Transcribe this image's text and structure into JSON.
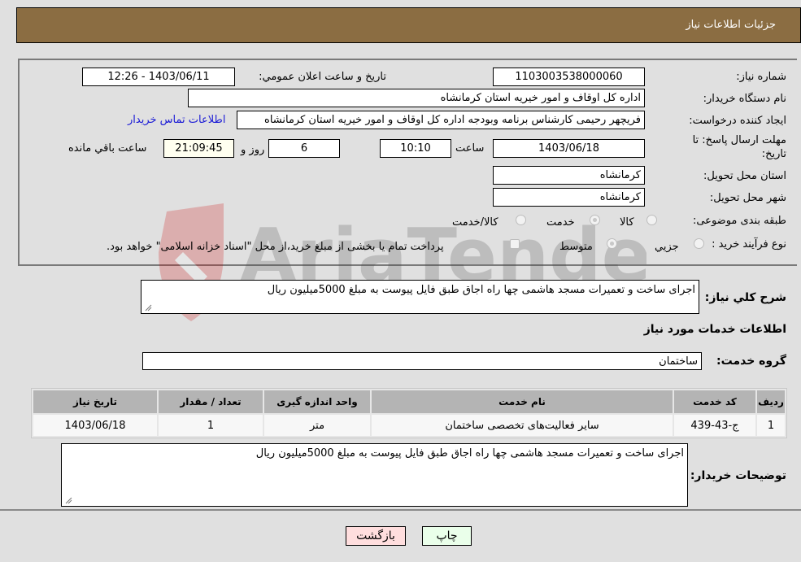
{
  "header": {
    "title": "جزئیات اطلاعات نیاز"
  },
  "form": {
    "need_number": {
      "label": "شماره نیاز:",
      "value": "1103003538000060"
    },
    "announce_datetime": {
      "label": "تاریخ و ساعت اعلان عمومي:",
      "value": "1403/06/11 - 12:26"
    },
    "buyer_org": {
      "label": "نام دستگاه خریدار:",
      "value": "اداره کل اوقاف و امور خیریه استان کرمانشاه"
    },
    "requester": {
      "label": "ایجاد کننده درخواست:",
      "value": "فریچهر رحیمی کارشناس برنامه وبودجه اداره کل اوقاف و امور خیریه استان کرمانشاه",
      "contact_link": "اطلاعات تماس خریدار"
    },
    "deadline": {
      "label_line1": "مهلت ارسال پاسخ: تا",
      "label_line2": "تاریخ:",
      "date": "1403/06/18",
      "time_label": "ساعت",
      "time": "10:10",
      "days": "6",
      "days_label": "روز و",
      "remaining": "21:09:45",
      "remaining_label": "ساعت باقي مانده"
    },
    "delivery_province": {
      "label": "استان محل تحویل:",
      "value": "کرمانشاه"
    },
    "delivery_city": {
      "label": "شهر محل تحویل:",
      "value": "کرمانشاه"
    },
    "category": {
      "label": "طبقه بندی موضوعی:",
      "options": [
        "کالا",
        "خدمت",
        "کالا/خدمت"
      ],
      "selected": "خدمت"
    },
    "purchase_type": {
      "label": "نوع فرآیند خرید :",
      "options": [
        "جزيي",
        "متوسط"
      ],
      "selected": "متوسط",
      "treasury_note": "پرداخت تمام یا بخشی از مبلغ خرید،از محل \"اسناد خزانه اسلامی\" خواهد بود."
    }
  },
  "summary": {
    "label": "شرح کلي نیاز:",
    "value": "اجرای ساخت و تعمیرات مسجد هاشمی چها راه اجاق طبق فایل پیوست به مبلغ 5000میلیون ریال"
  },
  "services_section": {
    "title": "اطلاعات خدمات مورد نیاز",
    "group_label": "گروه خدمت:",
    "group_value": "ساختمان",
    "table": {
      "headers": [
        "ردیف",
        "کد خدمت",
        "نام خدمت",
        "واحد اندازه گیری",
        "تعداد / مقدار",
        "تاریخ نیاز"
      ],
      "rows": [
        [
          "1",
          "ج-43-439",
          "سایر فعالیت‌های تخصصی ساختمان",
          "متر",
          "1",
          "1403/06/18"
        ]
      ]
    }
  },
  "buyer_notes": {
    "label": "توضیحات خریدار:",
    "value": "اجرای ساخت و تعمیرات مسجد هاشمی چها راه اجاق طبق فایل پیوست به مبلغ 5000میلیون ریال"
  },
  "buttons": {
    "print": "چاپ",
    "back": "بازگشت"
  },
  "watermark": {
    "text": "AriaTender.neT",
    "icon": "shield-logo-icon"
  },
  "colors": {
    "header_bg": "#8b6d42",
    "print_bg": "#eaffea",
    "back_bg": "#ffdede",
    "link": "#1a1ad6"
  }
}
